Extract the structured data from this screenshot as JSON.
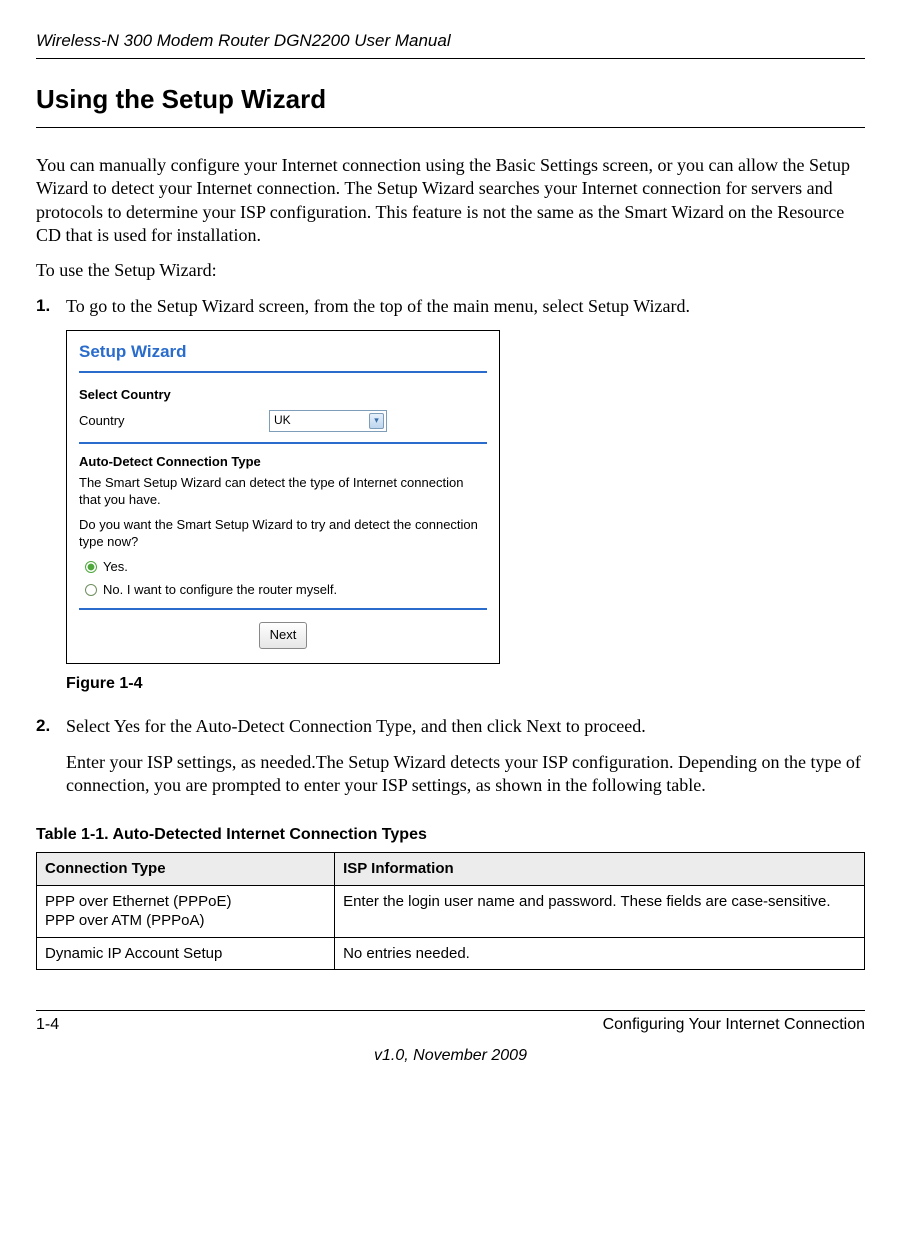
{
  "header": {
    "manual_title": "Wireless-N 300 Modem Router DGN2200 User Manual"
  },
  "section": {
    "heading": "Using the Setup Wizard",
    "intro_para": "You can manually configure your Internet connection using the Basic Settings screen, or you can allow the Setup Wizard to detect your Internet connection. The Setup Wizard searches your Internet connection for servers and protocols to determine your ISP configuration. This feature is not the same as the Smart Wizard on the Resource CD that is used for installation.",
    "intro_lead": "To use the Setup Wizard:"
  },
  "steps": {
    "s1_num": "1.",
    "s1_text": "To go to the Setup Wizard screen, from the top of the main menu, select Setup Wizard.",
    "s2_num": "2.",
    "s2_text": "Select Yes for the Auto-Detect Connection Type, and then click Next to proceed.",
    "s2_para": "Enter your ISP settings, as needed.The Setup Wizard detects your ISP configuration. Depending on the type of connection, you are prompted to enter your ISP settings, as shown in the following table."
  },
  "wizard": {
    "title": "Setup Wizard",
    "select_country_label": "Select Country",
    "country_label": "Country",
    "country_value": "UK",
    "autodetect_label": "Auto-Detect Connection Type",
    "autodetect_desc1": "The Smart Setup Wizard can detect the type of Internet connection that you have.",
    "autodetect_desc2": "Do you want the Smart Setup Wizard to try and detect the connection type now?",
    "opt_yes": "Yes.",
    "opt_no": "No. I want to configure the router myself.",
    "next_button": "Next"
  },
  "figure": {
    "caption": "Figure 1-4"
  },
  "table": {
    "caption": "Table 1-1. Auto-Detected Internet Connection Types",
    "col1": "Connection Type",
    "col2": "ISP Information",
    "rows": [
      {
        "type": "PPP over Ethernet (PPPoE)\nPPP over ATM (PPPoA)",
        "info": "Enter the login user name and password. These fields are case-sensitive."
      },
      {
        "type": "Dynamic IP Account Setup",
        "info": "No entries needed."
      }
    ]
  },
  "footer": {
    "page": "1-4",
    "chapter": "Configuring Your Internet Connection",
    "version": "v1.0, November 2009"
  }
}
